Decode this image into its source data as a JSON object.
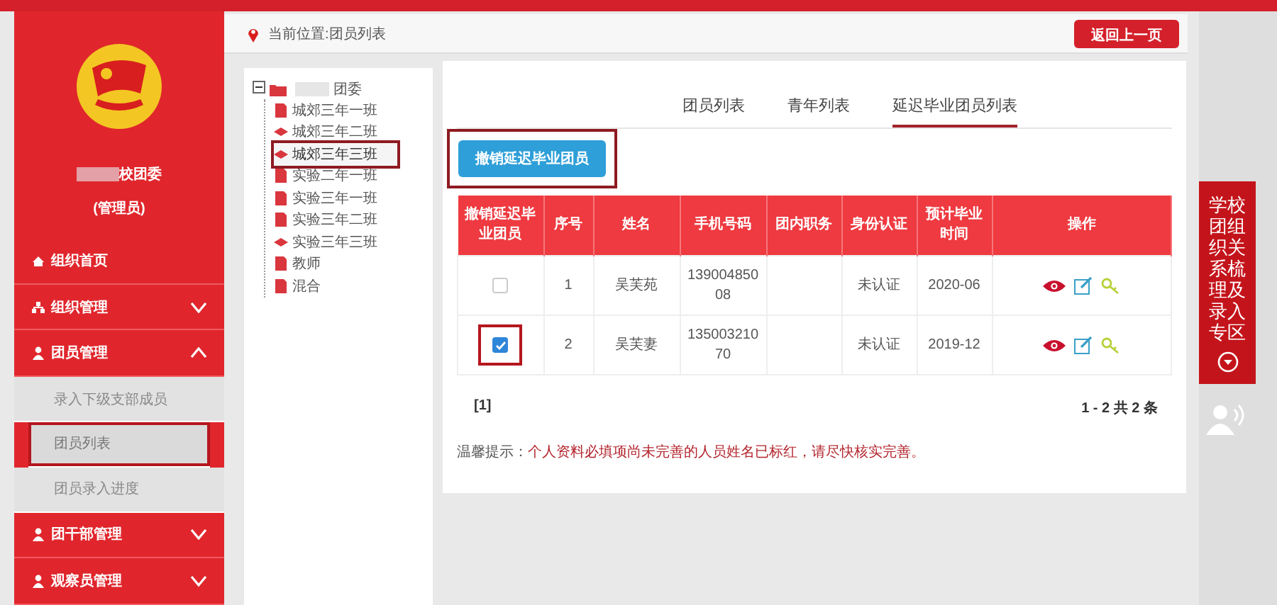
{
  "sidebar": {
    "org_name": "校团委",
    "role": "(管理员)",
    "items": [
      {
        "label": "组织首页"
      },
      {
        "label": "组织管理",
        "expanded": false
      },
      {
        "label": "团员管理",
        "expanded": true,
        "children": [
          {
            "label": "录入下级支部成员",
            "selected": false,
            "highlighted": false
          },
          {
            "label": "团员列表",
            "selected": true,
            "highlighted": true
          },
          {
            "label": "团员录入进度",
            "selected": false,
            "highlighted": false
          }
        ]
      },
      {
        "label": "团干部管理",
        "expanded": false
      },
      {
        "label": "观察员管理",
        "expanded": false
      }
    ]
  },
  "breadcrumb": "当前位置:团员列表",
  "back_button": "返回上一页",
  "tree": {
    "root": "团委",
    "expanded": true,
    "children": [
      {
        "label": "城郊三年一班",
        "kind": "file",
        "selected": false
      },
      {
        "label": "城郊三年二班",
        "kind": "hat",
        "selected": false
      },
      {
        "label": "城郊三年三班",
        "kind": "hat",
        "selected": true
      },
      {
        "label": "实验二年一班",
        "kind": "file",
        "selected": false
      },
      {
        "label": "实验三年一班",
        "kind": "file",
        "selected": false
      },
      {
        "label": "实验三年二班",
        "kind": "file",
        "selected": false
      },
      {
        "label": "实验三年三班",
        "kind": "hat",
        "selected": false
      },
      {
        "label": "教师",
        "kind": "file",
        "selected": false
      },
      {
        "label": "混合",
        "kind": "file",
        "selected": false
      }
    ]
  },
  "tabs": [
    {
      "label": "团员列表",
      "selected": false
    },
    {
      "label": "青年列表",
      "selected": false
    },
    {
      "label": "延迟毕业团员列表",
      "selected": true
    }
  ],
  "action_button": {
    "label": "撤销延迟毕业团员",
    "highlighted": true
  },
  "table": {
    "columns": [
      "撤销延迟毕业团员",
      "序号",
      "姓名",
      "手机号码",
      "团内职务",
      "身份认证",
      "预计毕业时间",
      "操作"
    ],
    "rows": [
      {
        "checked": false,
        "highlighted": false,
        "index": "1",
        "name": "吴芙苑",
        "phone": "13900485008",
        "role": "",
        "auth": "未认证",
        "graduation": "2020-06"
      },
      {
        "checked": true,
        "highlighted": true,
        "index": "2",
        "name": "吴芙妻",
        "phone": "13500321070",
        "role": "",
        "auth": "未认证",
        "graduation": "2019-12"
      }
    ]
  },
  "pagination": {
    "pages": "[1]",
    "summary": "1 - 2  共 2 条"
  },
  "hint": {
    "label": "温馨提示：",
    "message": "个人资料必填项尚未完善的人员姓名已标红，请尽快核实完善。"
  },
  "side_panel": {
    "title": "学校团组织关系梳理及录入专区"
  }
}
